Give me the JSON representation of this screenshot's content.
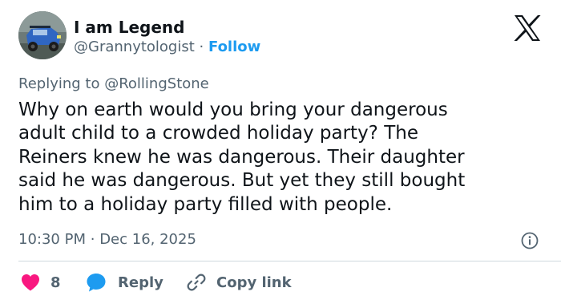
{
  "author": {
    "display_name": "I am Legend",
    "handle": "@Grannytologist",
    "separator": "·",
    "follow_label": "Follow"
  },
  "reply_context": {
    "prefix": "Replying to",
    "mention": "@RollingStone"
  },
  "tweet": {
    "text": "Why on earth would you bring your dangerous\nadult child to a crowded holiday party? The\nReiners knew he was dangerous. Their daughter\nsaid he was dangerous. But yet they still bought\nhim to a holiday party filled with people.",
    "time": "10:30 PM",
    "date_separator": "·",
    "date": "Dec 16, 2025"
  },
  "actions": {
    "like_count": "8",
    "reply_label": "Reply",
    "copy_link_label": "Copy link"
  },
  "icons": {
    "logo": "x-logo-icon",
    "info": "info-icon",
    "like": "heart-icon",
    "reply": "speech-bubble-icon",
    "copy": "link-icon"
  },
  "colors": {
    "text_primary": "#0f1419",
    "text_secondary": "#536471",
    "accent": "#1d9bf0",
    "like": "#f91880",
    "divider": "#cfd9de"
  }
}
